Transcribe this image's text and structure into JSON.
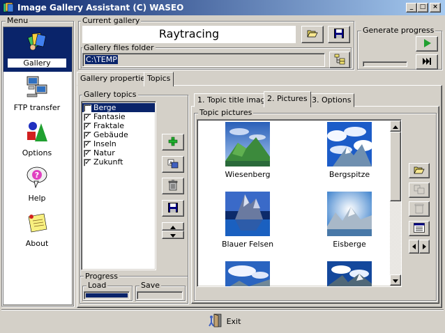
{
  "window": {
    "title": "Image Gallery Assistant (C) WASEO",
    "controls": [
      "_",
      "□",
      "×"
    ]
  },
  "menu": {
    "label": "Menu",
    "items": [
      {
        "label": "Gallery",
        "icon": "gallery-icon",
        "selected": true
      },
      {
        "label": "FTP transfer",
        "icon": "ftp-computer-icon"
      },
      {
        "label": "Options",
        "icon": "shapes-icon"
      },
      {
        "label": "Help",
        "icon": "help-bubble-icon"
      },
      {
        "label": "About",
        "icon": "note-pin-icon"
      }
    ]
  },
  "current_gallery": {
    "label": "Current gallery",
    "name": "Raytracing"
  },
  "gallery_files_folder": {
    "label": "Gallery files folder",
    "value": "C:\\TEMP"
  },
  "generate_progress": {
    "label": "Generate progress",
    "value": 0
  },
  "main_tabs": [
    {
      "label": "Gallery properties",
      "active": false
    },
    {
      "label": "Topics",
      "active": true
    }
  ],
  "gallery_topics": {
    "label": "Gallery topics",
    "items": [
      {
        "label": "Berge",
        "checked": true,
        "selected": true
      },
      {
        "label": "Fantasie",
        "checked": true
      },
      {
        "label": "Fraktale",
        "checked": true
      },
      {
        "label": "Gebäude",
        "checked": true
      },
      {
        "label": "Inseln",
        "checked": true
      },
      {
        "label": "Natur",
        "checked": true
      },
      {
        "label": "Zukunft",
        "checked": true
      }
    ]
  },
  "progress": {
    "label": "Progress",
    "load_label": "Load",
    "save_label": "Save",
    "load_value": 1.0,
    "save_value": 0
  },
  "topic_tabs": [
    {
      "label": "1. Topic title image",
      "active": false
    },
    {
      "label": "2. Pictures",
      "active": true
    },
    {
      "label": "3. Options",
      "active": false
    }
  ],
  "topic_pictures": {
    "label": "Topic pictures",
    "items": [
      {
        "caption": "Wiesenberg"
      },
      {
        "caption": "Bergspitze"
      },
      {
        "caption": "Blauer Felsen"
      },
      {
        "caption": "Eisberge"
      },
      {
        "caption": ""
      },
      {
        "caption": ""
      }
    ]
  },
  "footer": {
    "exit_label": "Exit"
  },
  "colors": {
    "face": "#d4d0c8",
    "title_start": "#0a246a",
    "title_end": "#a6caf0",
    "selection": "#0a246a",
    "progress_fill": "#0a246a",
    "folder_bg": "#d4d0c8"
  }
}
